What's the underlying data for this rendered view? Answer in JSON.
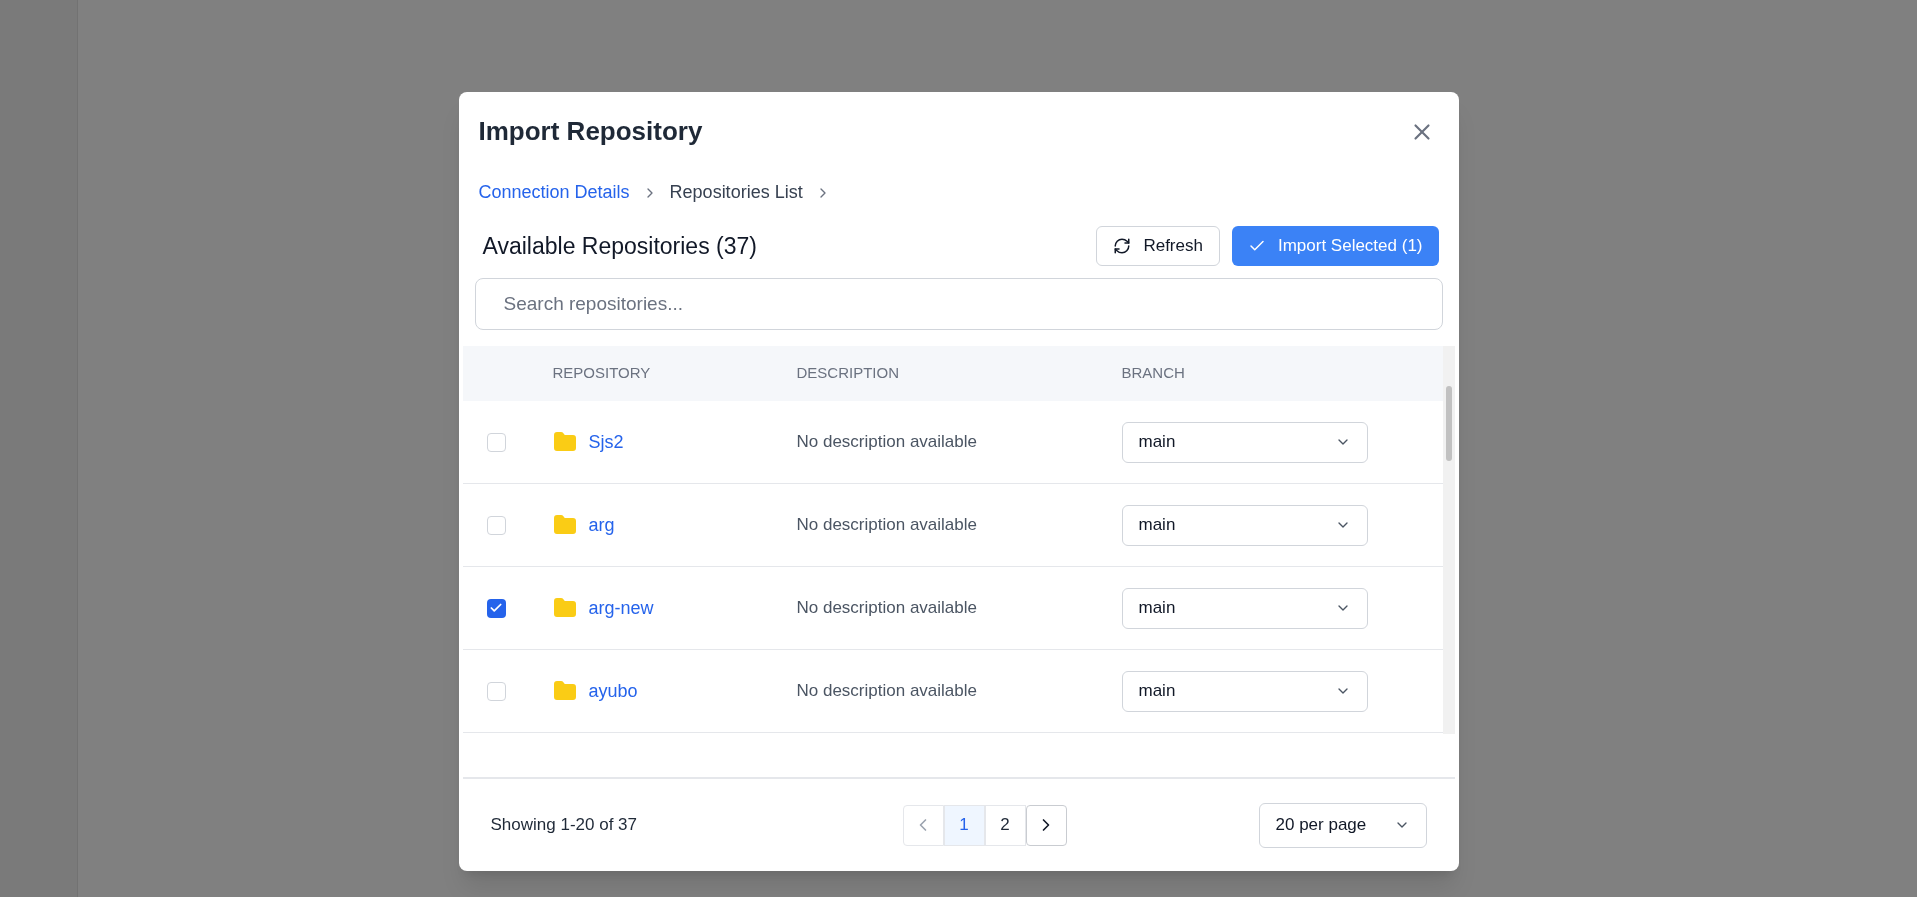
{
  "dialog": {
    "title": "Import Repository",
    "breadcrumb": [
      {
        "label": "Connection Details",
        "selected": false
      },
      {
        "label": "Repositories List",
        "selected": true
      }
    ],
    "section_title": "Available Repositories (37)",
    "buttons": [
      {
        "kind": "secondary",
        "label": "Refresh"
      },
      {
        "kind": "primary",
        "label": "Import Selected (1)"
      }
    ],
    "search": {
      "placeholder": "Search repositories..."
    },
    "table": {
      "columns": [
        "REPOSITORY",
        "DESCRIPTION",
        "BRANCH"
      ],
      "rows": [
        {
          "checked": false,
          "name": "Sjs2",
          "description": "No description available",
          "branch": "main"
        },
        {
          "checked": false,
          "name": "arg",
          "description": "No description available",
          "branch": "main"
        },
        {
          "checked": true,
          "name": "arg-new",
          "description": "No description available",
          "branch": "main"
        },
        {
          "checked": false,
          "name": "ayubo",
          "description": "No description available",
          "branch": "main"
        }
      ]
    },
    "footer": {
      "summary": "Showing 1-20 of 37",
      "pages": [
        {
          "label": "1",
          "selected": true
        },
        {
          "label": "2",
          "selected": false
        }
      ],
      "page_size": "20 per page"
    }
  }
}
